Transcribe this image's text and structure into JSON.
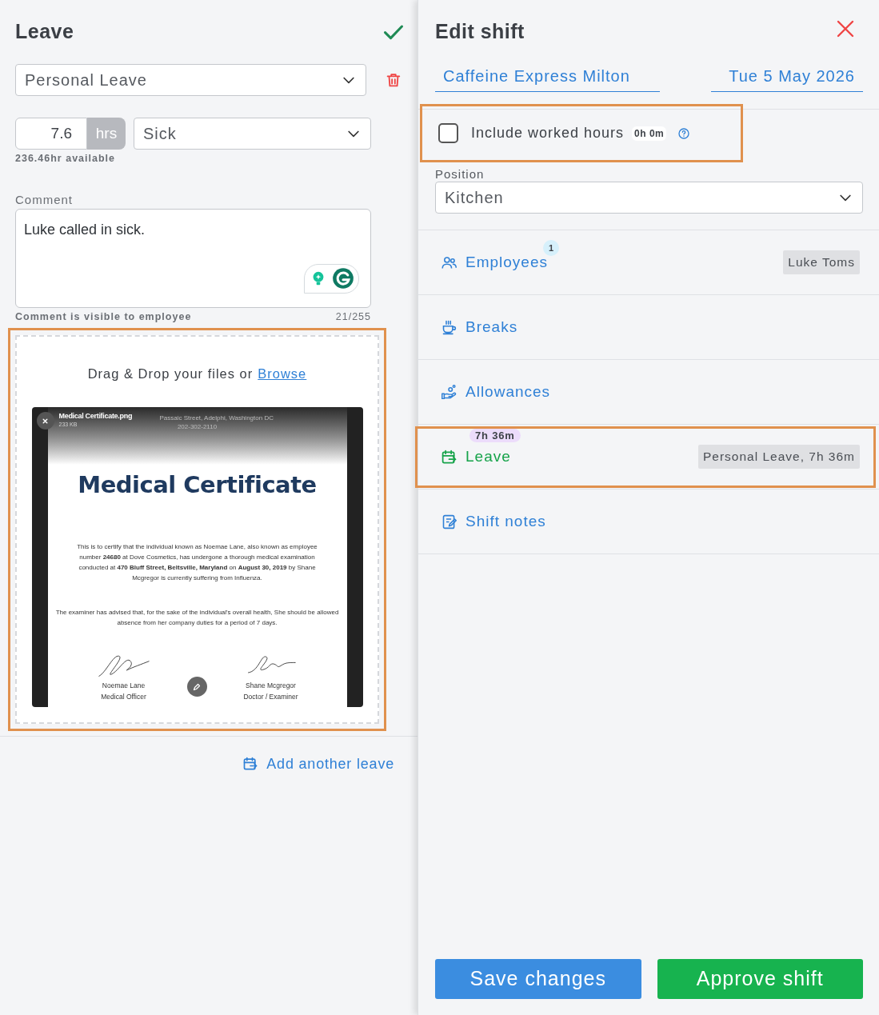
{
  "leave_panel": {
    "title": "Leave",
    "leave_type": {
      "value": "Personal Leave"
    },
    "hours": {
      "value": "7.6",
      "unit": "hrs"
    },
    "reason": {
      "value": "Sick"
    },
    "available": "236.46hr available",
    "comment": {
      "label": "Comment",
      "value": "Luke called in sick.",
      "hint": "Comment is visible to employee",
      "count": "21/255"
    },
    "upload": {
      "highlighted": true,
      "prompt": "Drag & Drop your files or",
      "link": "Browse",
      "file": {
        "name": "Medical Certificate.png",
        "size": "233 KB"
      },
      "document": {
        "address": [
          "Passaic Street, Adelphi, Washington DC",
          "202-302-2110"
        ],
        "title": "Medical Certificate",
        "paragraphs": [
          "This is to certify that the individual known as Noemae Lane, also known as employee number **24680** at Dove Cosmetics, has undergone a thorough medical examination conducted at **470 Bluff Street, Beltsville, Maryland** on **August 30, 2019** by Shane Mcgregor is currently suffering from Influenza.",
          "The examiner has advised that, for the sake of the individual's overall health, She should be allowed absence from her company duties for a period of 7 days."
        ],
        "signatures": [
          {
            "name": "Noemae Lane",
            "role": "Medical Officer"
          },
          {
            "name": "Shane Mcgregor",
            "role": "Doctor / Examiner"
          }
        ]
      }
    },
    "add_link": "Add another leave"
  },
  "edit_shift": {
    "title": "Edit shift",
    "location": "Caffeine Express Milton",
    "date": "Tue 5 May 2026",
    "include_hours": {
      "label": "Include worked hours",
      "checked": false,
      "badge": "0h 0m",
      "highlighted": true
    },
    "position": {
      "label": "Position",
      "value": "Kitchen"
    },
    "sections": [
      {
        "kind": "employees",
        "label": "Employees",
        "count": "1",
        "value": "Luke Toms",
        "highlighted": false
      },
      {
        "kind": "breaks",
        "label": "Breaks",
        "highlighted": false
      },
      {
        "kind": "allowances",
        "label": "Allowances",
        "highlighted": false
      },
      {
        "kind": "leave",
        "label": "Leave",
        "badge": "7h 36m",
        "value": "Personal Leave, 7h 36m",
        "highlighted": true
      },
      {
        "kind": "notes",
        "label": "Shift notes",
        "highlighted": false
      }
    ],
    "buttons": [
      {
        "kind": "save",
        "label": "Save changes"
      },
      {
        "kind": "approve",
        "label": "Approve shift"
      }
    ]
  }
}
